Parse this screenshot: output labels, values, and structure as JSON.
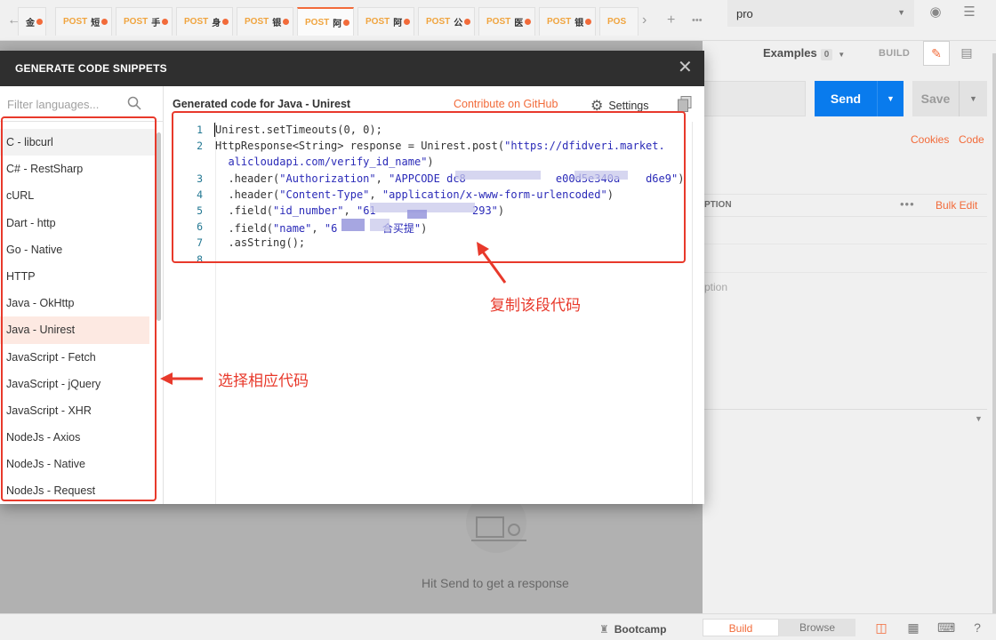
{
  "tabs": [
    {
      "method": "POST",
      "name": "短",
      "active": false
    },
    {
      "method": "POST",
      "name": "手",
      "active": false
    },
    {
      "method": "POST",
      "name": "身",
      "active": false
    },
    {
      "method": "POST",
      "name": "银",
      "active": false
    },
    {
      "method": "POST",
      "name": "阿",
      "active": true
    },
    {
      "method": "POST",
      "name": "阿",
      "active": false
    },
    {
      "method": "POST",
      "name": "公",
      "active": false
    },
    {
      "method": "POST",
      "name": "医",
      "active": false
    },
    {
      "method": "POST",
      "name": "银",
      "active": false
    },
    {
      "method": "POS",
      "name": "",
      "active": false
    }
  ],
  "first_tab_name": "金",
  "environment": "pro",
  "examples": {
    "label": "Examples",
    "count": "0"
  },
  "build_label": "BUILD",
  "send_label": "Send",
  "save_label": "Save",
  "cookies_label": "Cookies",
  "code_label": "Code",
  "params_table": {
    "desc_header": "PTION",
    "more": "•••",
    "bulk_edit": "Bulk Edit"
  },
  "description_placeholder": "ption",
  "response_empty": "Hit Send to get a response",
  "statusbar": {
    "bootcamp": "Bootcamp",
    "build": "Build",
    "browse": "Browse"
  },
  "modal": {
    "title": "GENERATE CODE SNIPPETS",
    "filter_placeholder": "Filter languages...",
    "languages": [
      "C - libcurl",
      "C# - RestSharp",
      "cURL",
      "Dart - http",
      "Go - Native",
      "HTTP",
      "Java - OkHttp",
      "Java - Unirest",
      "JavaScript - Fetch",
      "JavaScript - jQuery",
      "JavaScript - XHR",
      "NodeJs - Axios",
      "NodeJs - Native",
      "NodeJs - Request"
    ],
    "selected_language": "Java - Unirest",
    "code_title": "Generated code for Java - Unirest",
    "contribute": "Contribute on GitHub",
    "settings": "Settings",
    "code_lines": [
      {
        "n": "1",
        "parts": [
          [
            "k",
            "Unirest.setTimeouts(0, 0);"
          ]
        ]
      },
      {
        "n": "2",
        "parts": [
          [
            "k",
            "HttpResponse<String> response = Unirest.post("
          ],
          [
            "s",
            "\"https://dfidveri.market."
          ]
        ]
      },
      {
        "n": "",
        "parts": [
          [
            "s",
            "  alicloudapi.com/verify_id_name\""
          ],
          [
            "k",
            ")"
          ]
        ]
      },
      {
        "n": "3",
        "parts": [
          [
            "k",
            "  .header("
          ],
          [
            "s",
            "\"Authorization\""
          ],
          [
            "k",
            ", "
          ],
          [
            "s",
            "\"APPCODE dc8              e00d5e340a    d6e9\""
          ],
          [
            "k",
            ")"
          ]
        ]
      },
      {
        "n": "4",
        "parts": [
          [
            "k",
            "  .header("
          ],
          [
            "s",
            "\"Content-Type\""
          ],
          [
            "k",
            ", "
          ],
          [
            "s",
            "\"application/x-www-form-urlencoded\""
          ],
          [
            "k",
            ")"
          ]
        ]
      },
      {
        "n": "5",
        "parts": [
          [
            "k",
            "  .field("
          ],
          [
            "s",
            "\"id_number\""
          ],
          [
            "k",
            ", "
          ],
          [
            "s",
            "\"61               293\""
          ],
          [
            "k",
            ")"
          ]
        ]
      },
      {
        "n": "6",
        "parts": [
          [
            "k",
            "  .field("
          ],
          [
            "s",
            "\"name\""
          ],
          [
            "k",
            ", "
          ],
          [
            "s",
            "\"6       合买提\""
          ],
          [
            "k",
            ")"
          ]
        ]
      },
      {
        "n": "7",
        "parts": [
          [
            "k",
            "  .asString();"
          ]
        ]
      },
      {
        "n": "8",
        "parts": []
      }
    ]
  },
  "annotations": {
    "choose_code": "选择相应代码",
    "copy_code": "复制该段代码",
    "color": "#e8392b"
  }
}
